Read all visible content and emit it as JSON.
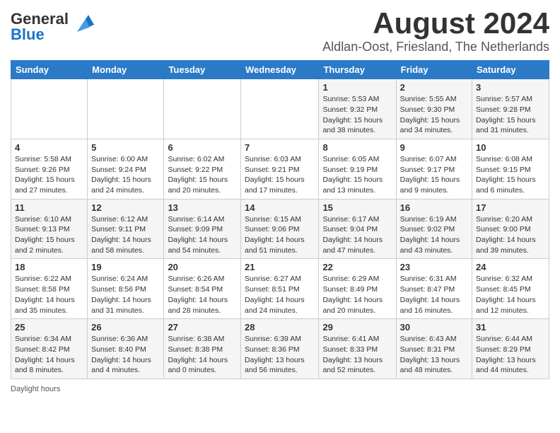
{
  "header": {
    "logo_general": "General",
    "logo_blue": "Blue",
    "main_title": "August 2024",
    "subtitle": "Aldlan-Oost, Friesland, The Netherlands"
  },
  "calendar": {
    "days_of_week": [
      "Sunday",
      "Monday",
      "Tuesday",
      "Wednesday",
      "Thursday",
      "Friday",
      "Saturday"
    ],
    "weeks": [
      [
        {
          "day": "",
          "info": ""
        },
        {
          "day": "",
          "info": ""
        },
        {
          "day": "",
          "info": ""
        },
        {
          "day": "",
          "info": ""
        },
        {
          "day": "1",
          "info": "Sunrise: 5:53 AM\nSunset: 9:32 PM\nDaylight: 15 hours and 38 minutes."
        },
        {
          "day": "2",
          "info": "Sunrise: 5:55 AM\nSunset: 9:30 PM\nDaylight: 15 hours and 34 minutes."
        },
        {
          "day": "3",
          "info": "Sunrise: 5:57 AM\nSunset: 9:28 PM\nDaylight: 15 hours and 31 minutes."
        }
      ],
      [
        {
          "day": "4",
          "info": "Sunrise: 5:58 AM\nSunset: 9:26 PM\nDaylight: 15 hours and 27 minutes."
        },
        {
          "day": "5",
          "info": "Sunrise: 6:00 AM\nSunset: 9:24 PM\nDaylight: 15 hours and 24 minutes."
        },
        {
          "day": "6",
          "info": "Sunrise: 6:02 AM\nSunset: 9:22 PM\nDaylight: 15 hours and 20 minutes."
        },
        {
          "day": "7",
          "info": "Sunrise: 6:03 AM\nSunset: 9:21 PM\nDaylight: 15 hours and 17 minutes."
        },
        {
          "day": "8",
          "info": "Sunrise: 6:05 AM\nSunset: 9:19 PM\nDaylight: 15 hours and 13 minutes."
        },
        {
          "day": "9",
          "info": "Sunrise: 6:07 AM\nSunset: 9:17 PM\nDaylight: 15 hours and 9 minutes."
        },
        {
          "day": "10",
          "info": "Sunrise: 6:08 AM\nSunset: 9:15 PM\nDaylight: 15 hours and 6 minutes."
        }
      ],
      [
        {
          "day": "11",
          "info": "Sunrise: 6:10 AM\nSunset: 9:13 PM\nDaylight: 15 hours and 2 minutes."
        },
        {
          "day": "12",
          "info": "Sunrise: 6:12 AM\nSunset: 9:11 PM\nDaylight: 14 hours and 58 minutes."
        },
        {
          "day": "13",
          "info": "Sunrise: 6:14 AM\nSunset: 9:09 PM\nDaylight: 14 hours and 54 minutes."
        },
        {
          "day": "14",
          "info": "Sunrise: 6:15 AM\nSunset: 9:06 PM\nDaylight: 14 hours and 51 minutes."
        },
        {
          "day": "15",
          "info": "Sunrise: 6:17 AM\nSunset: 9:04 PM\nDaylight: 14 hours and 47 minutes."
        },
        {
          "day": "16",
          "info": "Sunrise: 6:19 AM\nSunset: 9:02 PM\nDaylight: 14 hours and 43 minutes."
        },
        {
          "day": "17",
          "info": "Sunrise: 6:20 AM\nSunset: 9:00 PM\nDaylight: 14 hours and 39 minutes."
        }
      ],
      [
        {
          "day": "18",
          "info": "Sunrise: 6:22 AM\nSunset: 8:58 PM\nDaylight: 14 hours and 35 minutes."
        },
        {
          "day": "19",
          "info": "Sunrise: 6:24 AM\nSunset: 8:56 PM\nDaylight: 14 hours and 31 minutes."
        },
        {
          "day": "20",
          "info": "Sunrise: 6:26 AM\nSunset: 8:54 PM\nDaylight: 14 hours and 28 minutes."
        },
        {
          "day": "21",
          "info": "Sunrise: 6:27 AM\nSunset: 8:51 PM\nDaylight: 14 hours and 24 minutes."
        },
        {
          "day": "22",
          "info": "Sunrise: 6:29 AM\nSunset: 8:49 PM\nDaylight: 14 hours and 20 minutes."
        },
        {
          "day": "23",
          "info": "Sunrise: 6:31 AM\nSunset: 8:47 PM\nDaylight: 14 hours and 16 minutes."
        },
        {
          "day": "24",
          "info": "Sunrise: 6:32 AM\nSunset: 8:45 PM\nDaylight: 14 hours and 12 minutes."
        }
      ],
      [
        {
          "day": "25",
          "info": "Sunrise: 6:34 AM\nSunset: 8:42 PM\nDaylight: 14 hours and 8 minutes."
        },
        {
          "day": "26",
          "info": "Sunrise: 6:36 AM\nSunset: 8:40 PM\nDaylight: 14 hours and 4 minutes."
        },
        {
          "day": "27",
          "info": "Sunrise: 6:38 AM\nSunset: 8:38 PM\nDaylight: 14 hours and 0 minutes."
        },
        {
          "day": "28",
          "info": "Sunrise: 6:39 AM\nSunset: 8:36 PM\nDaylight: 13 hours and 56 minutes."
        },
        {
          "day": "29",
          "info": "Sunrise: 6:41 AM\nSunset: 8:33 PM\nDaylight: 13 hours and 52 minutes."
        },
        {
          "day": "30",
          "info": "Sunrise: 6:43 AM\nSunset: 8:31 PM\nDaylight: 13 hours and 48 minutes."
        },
        {
          "day": "31",
          "info": "Sunrise: 6:44 AM\nSunset: 8:29 PM\nDaylight: 13 hours and 44 minutes."
        }
      ]
    ]
  },
  "footer": {
    "note": "Daylight hours"
  }
}
